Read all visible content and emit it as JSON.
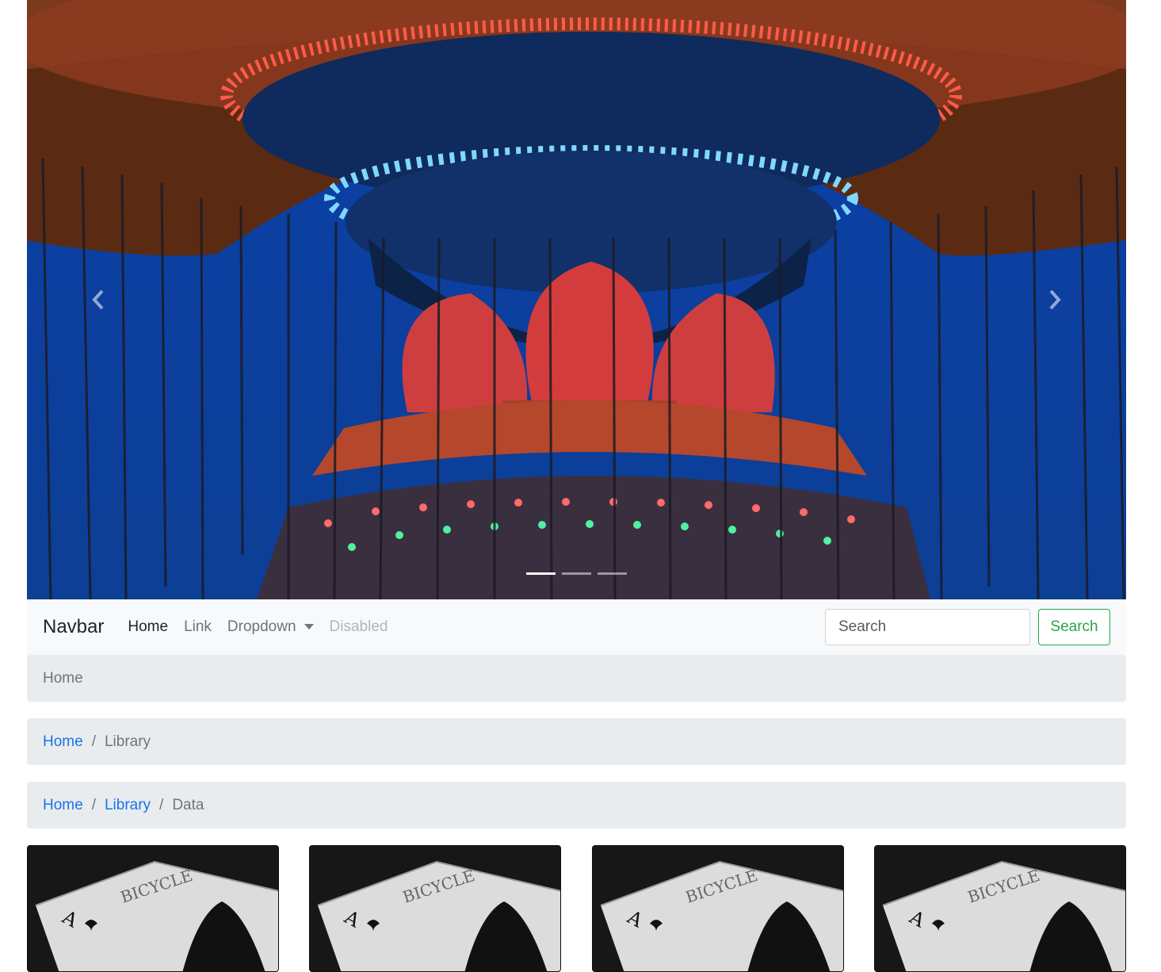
{
  "carousel": {
    "prev_icon": "chevron-left-icon",
    "next_icon": "chevron-right-icon",
    "slides": 3,
    "active_index": 0
  },
  "navbar": {
    "brand": "Navbar",
    "links": [
      {
        "label": "Home",
        "state": "active"
      },
      {
        "label": "Link",
        "state": "normal"
      },
      {
        "label": "Dropdown",
        "state": "dropdown"
      },
      {
        "label": "Disabled",
        "state": "disabled"
      }
    ],
    "search_placeholder": "Search",
    "search_button": "Search",
    "colors": {
      "background": "#f8f9fa",
      "search_button": "#28a745"
    }
  },
  "breadcrumbs": [
    {
      "items": [
        "Home"
      ]
    },
    {
      "items": [
        "Home",
        "Library"
      ]
    },
    {
      "items": [
        "Home",
        "Library",
        "Data"
      ]
    }
  ],
  "cards": [
    {
      "image": "ace-of-spades-card"
    },
    {
      "image": "ace-of-spades-card"
    },
    {
      "image": "ace-of-spades-card"
    },
    {
      "image": "ace-of-spades-card"
    }
  ],
  "colors": {
    "link": "#1a73e8",
    "breadcrumb_bg": "#e9ecef"
  }
}
